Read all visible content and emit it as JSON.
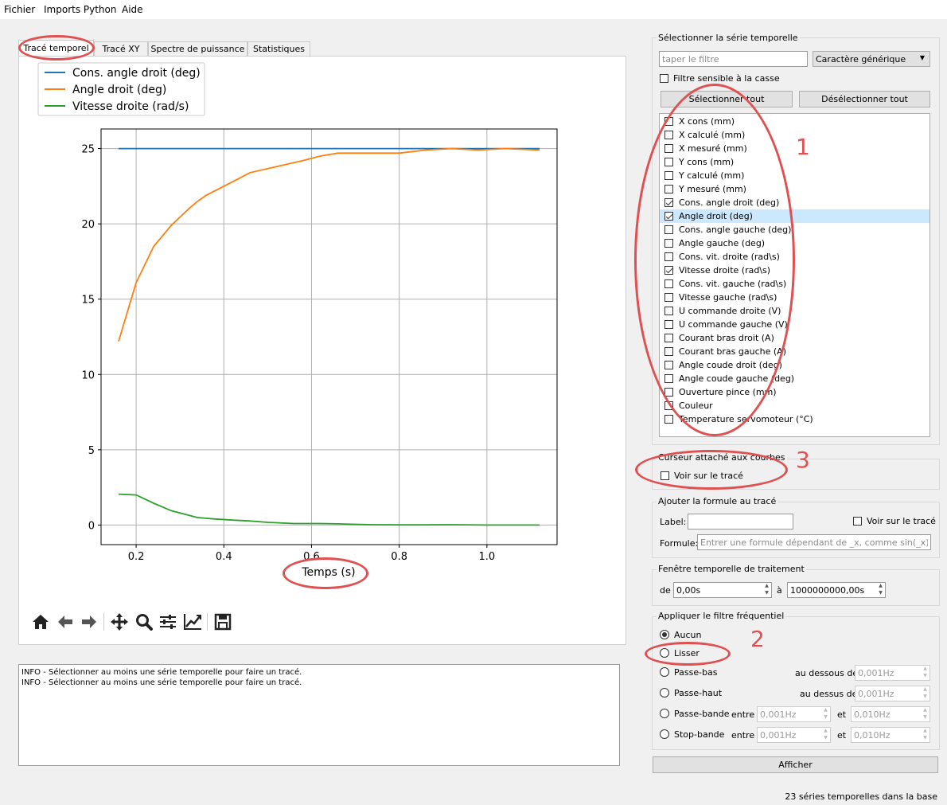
{
  "menu": {
    "items": [
      "Fichier",
      "Imports Python",
      "Aide"
    ]
  },
  "tabs": [
    {
      "label": "Tracé temporel",
      "active": true
    },
    {
      "label": "Tracé XY",
      "active": false
    },
    {
      "label": "Spectre de puissance",
      "active": false
    },
    {
      "label": "Statistiques",
      "active": false
    }
  ],
  "chart_data": {
    "type": "line",
    "xlabel": "Temps (s)",
    "ylabel": "",
    "xlim": [
      0.12,
      1.16
    ],
    "ylim": [
      -1.3,
      26.3
    ],
    "xticks": [
      0.2,
      0.4,
      0.6,
      0.8,
      1.0
    ],
    "xtick_labels": [
      "0.2",
      "0.4",
      "0.6",
      "0.8",
      "1.0"
    ],
    "yticks": [
      0,
      5,
      10,
      15,
      20,
      25
    ],
    "ytick_labels": [
      "0",
      "5",
      "10",
      "15",
      "20",
      "25"
    ],
    "grid": true,
    "legend_position": "top-left",
    "series": [
      {
        "name": "Cons. angle droit (deg)",
        "color": "#1f77b4",
        "x": [
          0.16,
          1.12
        ],
        "y": [
          25.0,
          25.0
        ]
      },
      {
        "name": "Angle droit (deg)",
        "color": "#ff7f0e",
        "x": [
          0.16,
          0.2,
          0.24,
          0.28,
          0.32,
          0.34,
          0.36,
          0.4,
          0.46,
          0.52,
          0.58,
          0.62,
          0.66,
          0.72,
          0.8,
          0.86,
          0.92,
          0.98,
          1.04,
          1.12
        ],
        "y": [
          12.2,
          16.1,
          18.5,
          19.9,
          21.0,
          21.5,
          21.9,
          22.5,
          23.4,
          23.8,
          24.2,
          24.5,
          24.7,
          24.7,
          24.7,
          24.9,
          25.0,
          24.9,
          25.0,
          24.9
        ]
      },
      {
        "name": "Vitesse droite (rad/s)",
        "color": "#2ca02c",
        "x": [
          0.16,
          0.2,
          0.24,
          0.28,
          0.34,
          0.38,
          0.42,
          0.46,
          0.5,
          0.56,
          0.62,
          0.66,
          0.7,
          0.74,
          0.8,
          0.86,
          0.92,
          1.0,
          1.12
        ],
        "y": [
          2.05,
          2.0,
          1.45,
          0.95,
          0.5,
          0.4,
          0.33,
          0.27,
          0.18,
          0.1,
          0.1,
          0.08,
          0.05,
          0.02,
          0.01,
          0.01,
          0.02,
          0.0,
          0.0
        ]
      }
    ]
  },
  "toolbar": {
    "icons": [
      "home-icon",
      "back-arrow-icon",
      "forward-arrow-icon",
      "pan-icon",
      "zoom-icon",
      "subplots-config-icon",
      "edit-curves-icon",
      "save-icon"
    ]
  },
  "log": {
    "lines": [
      "INFO - Sélectionner au moins une série temporelle pour faire un tracé.",
      "INFO - Sélectionner au moins une série temporelle pour faire un tracé."
    ]
  },
  "series_panel": {
    "title": "Sélectionner la série temporelle",
    "filter_placeholder": "taper le filtre",
    "filter_mode": "Caractère générique",
    "case_sensitive_label": "Filtre sensible à la casse",
    "select_all": "Sélectionner tout",
    "deselect_all": "Désélectionner tout",
    "items": [
      {
        "label": "X cons (mm)",
        "checked": false
      },
      {
        "label": "X calculé (mm)",
        "checked": false
      },
      {
        "label": "X mesuré (mm)",
        "checked": false
      },
      {
        "label": "Y cons (mm)",
        "checked": false
      },
      {
        "label": "Y calculé (mm)",
        "checked": false
      },
      {
        "label": "Y mesuré (mm)",
        "checked": false
      },
      {
        "label": "Cons. angle droit (deg)",
        "checked": true
      },
      {
        "label": "Angle droit (deg)",
        "checked": true,
        "selected": true
      },
      {
        "label": "Cons. angle gauche (deg)",
        "checked": false
      },
      {
        "label": "Angle gauche (deg)",
        "checked": false
      },
      {
        "label": "Cons. vit. droite (rad\\s)",
        "checked": false
      },
      {
        "label": "Vitesse droite (rad\\s)",
        "checked": true
      },
      {
        "label": "Cons. vit. gauche (rad\\s)",
        "checked": false
      },
      {
        "label": "Vitesse gauche (rad\\s)",
        "checked": false
      },
      {
        "label": "U commande droite (V)",
        "checked": false
      },
      {
        "label": "U commande gauche (V)",
        "checked": false
      },
      {
        "label": "Courant bras droit (A)",
        "checked": false
      },
      {
        "label": "Courant bras gauche (A)",
        "checked": false
      },
      {
        "label": "Angle coude droit (deg)",
        "checked": false
      },
      {
        "label": "Angle coude gauche (deg)",
        "checked": false
      },
      {
        "label": "Ouverture pince (mm)",
        "checked": false
      },
      {
        "label": "Couleur",
        "checked": false
      },
      {
        "label": "Temperature servomoteur (°C)",
        "checked": false
      }
    ]
  },
  "cursor_panel": {
    "title": "Curseur attaché aux courbes",
    "show_label": "Voir sur le tracé"
  },
  "formula_panel": {
    "title": "Ajouter la formule au tracé",
    "label_label": "Label:",
    "label_value": "",
    "show_label": "Voir sur le tracé",
    "formula_label": "Formule:",
    "formula_placeholder": "Entrer une formule dépendant de _x, comme sin(_x)"
  },
  "window_panel": {
    "title": "Fenêtre temporelle de traitement",
    "from_label": "de",
    "from_value": "0,00s",
    "to_label": "à",
    "to_value": "1000000000,00s"
  },
  "filter_panel": {
    "title": "Appliquer le filtre fréquentiel",
    "none": "Aucun",
    "smooth": "Lisser",
    "lowpass": "Passe-bas",
    "lowpass_below": "au dessous de",
    "lowpass_value": "0,001Hz",
    "highpass": "Passe-haut",
    "highpass_above": "au dessus de",
    "highpass_value": "0,001Hz",
    "bandpass": "Passe-bande",
    "bandpass_between": "entre",
    "bandpass_low": "0,001Hz",
    "bandpass_and": "et",
    "bandpass_high": "0,010Hz",
    "bandstop": "Stop-bande",
    "bandstop_between": "entre",
    "bandstop_low": "0,001Hz",
    "bandstop_and": "et",
    "bandstop_high": "0,010Hz",
    "selected": "none"
  },
  "display_button": "Afficher",
  "status": "23 séries temporelles dans la base",
  "annotations": {
    "n1": "1",
    "n2": "2",
    "n3": "3"
  },
  "annotation_color": "#e05050"
}
